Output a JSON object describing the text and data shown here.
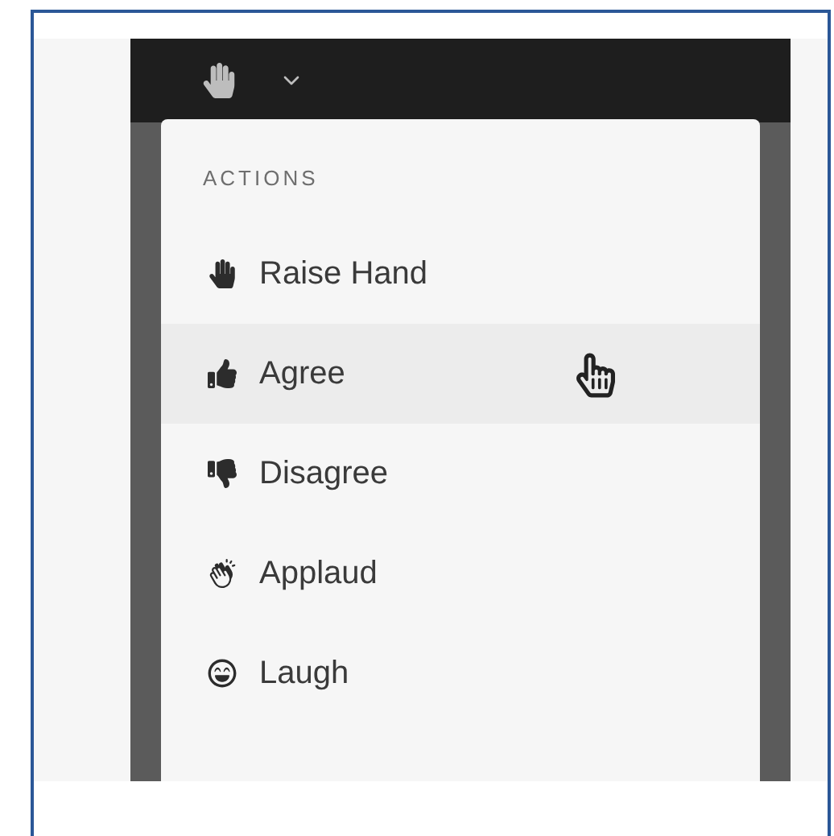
{
  "menu": {
    "heading": "ACTIONS",
    "items": [
      {
        "label": "Raise Hand",
        "highlighted": false
      },
      {
        "label": "Agree",
        "highlighted": true
      },
      {
        "label": "Disagree",
        "highlighted": false
      },
      {
        "label": "Applaud",
        "highlighted": false
      },
      {
        "label": "Laugh",
        "highlighted": false
      }
    ]
  }
}
